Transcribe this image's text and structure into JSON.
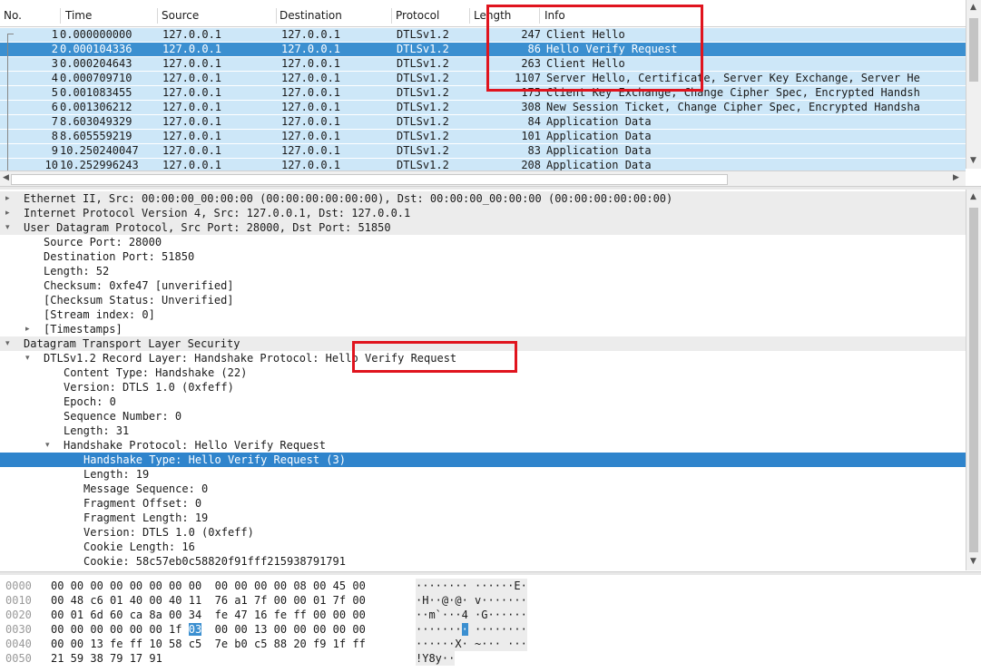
{
  "packet_list": {
    "columns": [
      "No.",
      "Time",
      "Source",
      "Destination",
      "Protocol",
      "Length",
      "Info"
    ],
    "rows": [
      {
        "no": "1",
        "time": "0.000000000",
        "src": "127.0.0.1",
        "dst": "127.0.0.1",
        "proto": "DTLSv1.2",
        "len": "247",
        "info": "Client Hello"
      },
      {
        "no": "2",
        "time": "0.000104336",
        "src": "127.0.0.1",
        "dst": "127.0.0.1",
        "proto": "DTLSv1.2",
        "len": "86",
        "info": "Hello Verify Request"
      },
      {
        "no": "3",
        "time": "0.000204643",
        "src": "127.0.0.1",
        "dst": "127.0.0.1",
        "proto": "DTLSv1.2",
        "len": "263",
        "info": "Client Hello"
      },
      {
        "no": "4",
        "time": "0.000709710",
        "src": "127.0.0.1",
        "dst": "127.0.0.1",
        "proto": "DTLSv1.2",
        "len": "1107",
        "info": "Server Hello, Certificate, Server Key Exchange, Server He"
      },
      {
        "no": "5",
        "time": "0.001083455",
        "src": "127.0.0.1",
        "dst": "127.0.0.1",
        "proto": "DTLSv1.2",
        "len": "175",
        "info": "Client Key Exchange, Change Cipher Spec, Encrypted Handsh"
      },
      {
        "no": "6",
        "time": "0.001306212",
        "src": "127.0.0.1",
        "dst": "127.0.0.1",
        "proto": "DTLSv1.2",
        "len": "308",
        "info": "New Session Ticket, Change Cipher Spec, Encrypted Handsha"
      },
      {
        "no": "7",
        "time": "8.603049329",
        "src": "127.0.0.1",
        "dst": "127.0.0.1",
        "proto": "DTLSv1.2",
        "len": "84",
        "info": "Application Data"
      },
      {
        "no": "8",
        "time": "8.605559219",
        "src": "127.0.0.1",
        "dst": "127.0.0.1",
        "proto": "DTLSv1.2",
        "len": "101",
        "info": "Application Data"
      },
      {
        "no": "9",
        "time": "10.250240047",
        "src": "127.0.0.1",
        "dst": "127.0.0.1",
        "proto": "DTLSv1.2",
        "len": "83",
        "info": "Application Data"
      },
      {
        "no": "10",
        "time": "10.252996243",
        "src": "127.0.0.1",
        "dst": "127.0.0.1",
        "proto": "DTLSv1.2",
        "len": "208",
        "info": "Application Data"
      }
    ],
    "selected_row": 1
  },
  "details": [
    {
      "indent": 0,
      "exp": "collapsed",
      "text": "Ethernet II, Src: 00:00:00_00:00:00 (00:00:00:00:00:00), Dst: 00:00:00_00:00:00 (00:00:00:00:00:00)",
      "style": "band"
    },
    {
      "indent": 0,
      "exp": "collapsed",
      "text": "Internet Protocol Version 4, Src: 127.0.0.1, Dst: 127.0.0.1",
      "style": "band"
    },
    {
      "indent": 0,
      "exp": "expanded",
      "text": "User Datagram Protocol, Src Port: 28000, Dst Port: 51850",
      "style": "band"
    },
    {
      "indent": 1,
      "exp": "none",
      "text": "Source Port: 28000",
      "style": ""
    },
    {
      "indent": 1,
      "exp": "none",
      "text": "Destination Port: 51850",
      "style": ""
    },
    {
      "indent": 1,
      "exp": "none",
      "text": "Length: 52",
      "style": ""
    },
    {
      "indent": 1,
      "exp": "none",
      "text": "Checksum: 0xfe47 [unverified]",
      "style": ""
    },
    {
      "indent": 1,
      "exp": "none",
      "text": "[Checksum Status: Unverified]",
      "style": ""
    },
    {
      "indent": 1,
      "exp": "none",
      "text": "[Stream index: 0]",
      "style": ""
    },
    {
      "indent": 1,
      "exp": "collapsed",
      "text": "[Timestamps]",
      "style": ""
    },
    {
      "indent": 0,
      "exp": "expanded",
      "text": "Datagram Transport Layer Security",
      "style": "band"
    },
    {
      "indent": 1,
      "exp": "expanded",
      "text": "DTLSv1.2 Record Layer: Handshake Protocol: Hello Verify Request",
      "style": ""
    },
    {
      "indent": 2,
      "exp": "none",
      "text": "Content Type: Handshake (22)",
      "style": ""
    },
    {
      "indent": 2,
      "exp": "none",
      "text": "Version: DTLS 1.0 (0xfeff)",
      "style": ""
    },
    {
      "indent": 2,
      "exp": "none",
      "text": "Epoch: 0",
      "style": ""
    },
    {
      "indent": 2,
      "exp": "none",
      "text": "Sequence Number: 0",
      "style": ""
    },
    {
      "indent": 2,
      "exp": "none",
      "text": "Length: 31",
      "style": ""
    },
    {
      "indent": 2,
      "exp": "expanded",
      "text": "Handshake Protocol: Hello Verify Request",
      "style": ""
    },
    {
      "indent": 3,
      "exp": "none",
      "text": "Handshake Type: Hello Verify Request (3)",
      "style": "hl"
    },
    {
      "indent": 3,
      "exp": "none",
      "text": "Length: 19",
      "style": ""
    },
    {
      "indent": 3,
      "exp": "none",
      "text": "Message Sequence: 0",
      "style": ""
    },
    {
      "indent": 3,
      "exp": "none",
      "text": "Fragment Offset: 0",
      "style": ""
    },
    {
      "indent": 3,
      "exp": "none",
      "text": "Fragment Length: 19",
      "style": ""
    },
    {
      "indent": 3,
      "exp": "none",
      "text": "Version: DTLS 1.0 (0xfeff)",
      "style": ""
    },
    {
      "indent": 3,
      "exp": "none",
      "text": "Cookie Length: 16",
      "style": ""
    },
    {
      "indent": 3,
      "exp": "none",
      "text": "Cookie: 58c57eb0c58820f91fff215938791791",
      "style": ""
    }
  ],
  "bytes": [
    {
      "offset": "0000",
      "hex_a": "00 00 00 00 00 00 00 00",
      "hex_b": "00 00 00 00 08 00 45 00",
      "ascii": "········ ······E·"
    },
    {
      "offset": "0010",
      "hex_a": "00 48 c6 01 40 00 40 11",
      "hex_b": "76 a1 7f 00 00 01 7f 00",
      "ascii": "·H··@·@· v·······"
    },
    {
      "offset": "0020",
      "hex_a": "00 01 6d 60 ca 8a 00 34",
      "hex_b": "fe 47 16 fe ff 00 00 00",
      "ascii": "··m`···4 ·G······"
    },
    {
      "offset": "0030",
      "hex_a": "00 00 00 00 00 00 1f",
      "hl_byte": "03",
      "hex_b": "00 00 13 00 00 00 00 00",
      "ascii_pre": "·······",
      "ascii_hl": "·",
      "ascii_post": " ········"
    },
    {
      "offset": "0040",
      "hex_a": "00 00 13 fe ff 10 58 c5",
      "hex_b": "7e b0 c5 88 20 f9 1f ff",
      "ascii": "······X· ~··· ···"
    },
    {
      "offset": "0050",
      "hex_a": "21 59 38 79 17 91",
      "hex_b": "",
      "ascii": "!Y8y··"
    }
  ],
  "colors": {
    "row_bg": "#cde7f8",
    "selected": "#3b8fd0",
    "annotation": "#e0141e"
  },
  "icons": {
    "collapsed": "triangle-right",
    "expanded": "triangle-down"
  }
}
